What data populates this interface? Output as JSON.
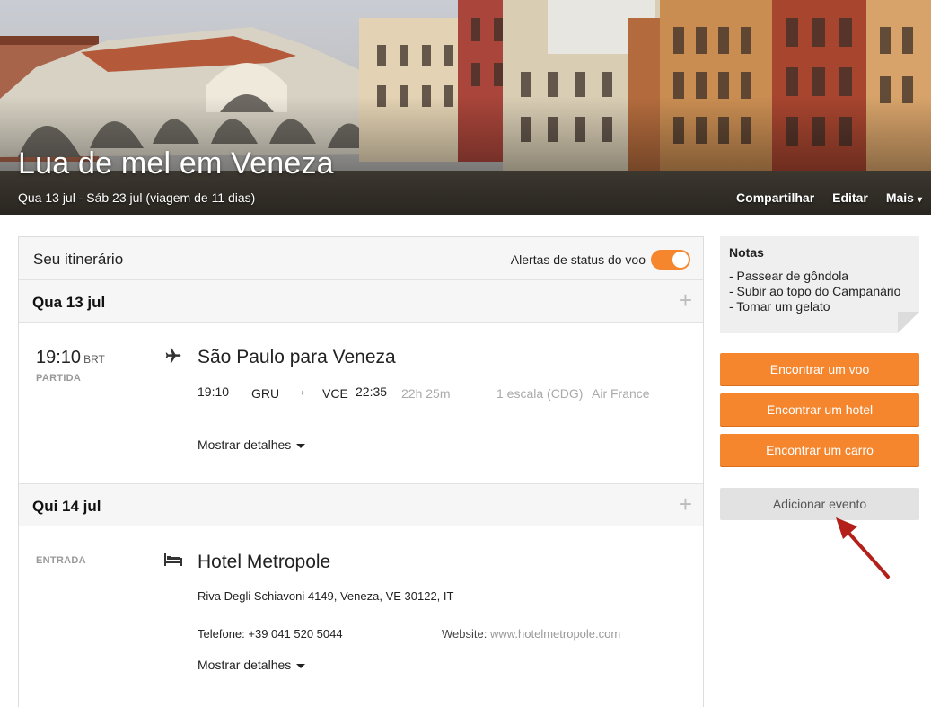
{
  "hero": {
    "title": "Lua de mel em Veneza",
    "dates": "Qua 13 jul - Sáb 23 jul (viagem de 11 dias)",
    "actions": [
      "Compartilhar",
      "Editar",
      "Mais"
    ]
  },
  "itinerary": {
    "title": "Seu itinerário",
    "alerts_label": "Alertas de status do voo",
    "alerts_on": true,
    "days": [
      {
        "label": "Qua 13 jul",
        "event": {
          "time": "19:10",
          "tz": "BRT",
          "kind": "PARTIDA",
          "icon": "airplane-icon",
          "title": "São Paulo para Veneza",
          "depart_time": "19:10",
          "from": "GRU",
          "arrow": "→",
          "to": "VCE",
          "arrive_time": "22:35",
          "duration": "22h 25m",
          "stops": "1 escala (CDG)",
          "airline": "Air France",
          "details": "Mostrar detalhes"
        }
      },
      {
        "label": "Qui 14 jul",
        "event": {
          "kind": "ENTRADA",
          "icon": "bed-icon",
          "title": "Hotel Metropole",
          "address": "Riva Degli Schiavoni 4149, Veneza, VE 30122, IT",
          "phone_label": "Telefone:",
          "phone": "+39 041 520 5044",
          "website_label": "Website:",
          "website": "www.hotelmetropole.com",
          "details": "Mostrar detalhes"
        }
      }
    ]
  },
  "sidebar": {
    "notes_title": "Notas",
    "notes": [
      "- Passear de gôndola",
      "- Subir ao topo do Campanário",
      "- Tomar um gelato"
    ],
    "buttons": {
      "flight": "Encontrar um voo",
      "hotel": "Encontrar um hotel",
      "car": "Encontrar um carro",
      "event": "Adicionar evento"
    }
  },
  "colors": {
    "accent": "#f5862e",
    "annotation_arrow": "#b3201a"
  }
}
